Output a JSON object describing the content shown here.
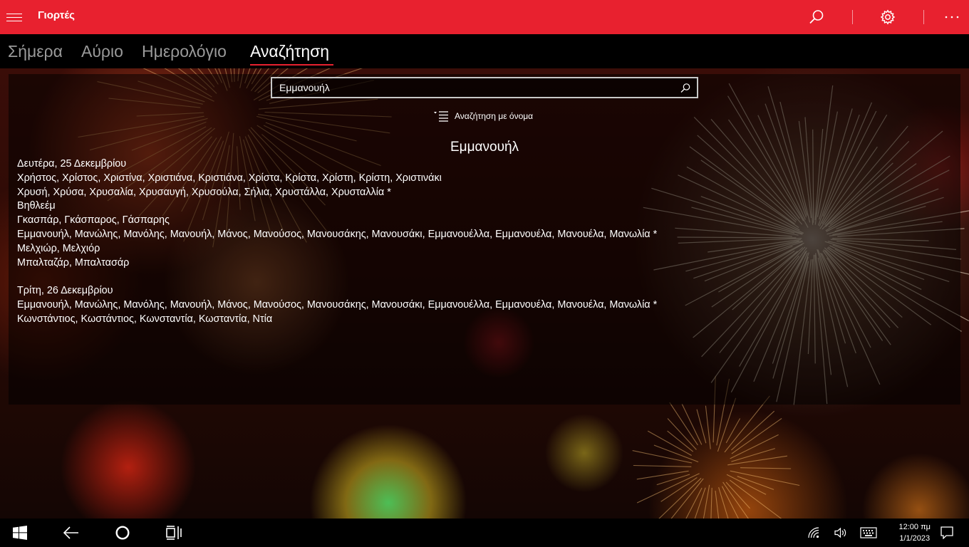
{
  "app": {
    "title": "Γιορτές"
  },
  "tabs": [
    {
      "label": "Σήμερα"
    },
    {
      "label": "Αύριο"
    },
    {
      "label": "Ημερολόγιο"
    },
    {
      "label": "Αναζήτηση",
      "active": true
    }
  ],
  "search": {
    "value": "Εμμανουήλ",
    "filter_label": "Αναζήτηση με όνομα"
  },
  "result": {
    "title": "Εμμανουήλ",
    "days": [
      {
        "date": "Δευτέρα, 25 Δεκεμβρίου",
        "names": [
          "Χρήστος, Χρίστος, Χριστίνα, Χριστιάνα, Κριστιάνα, Χρίστα, Κρίστα, Χρίστη, Κρίστη, Χριστινάκι",
          "Χρυσή, Χρύσα, Χρυσαλία, Χρυσαυγή, Χρυσούλα, Σήλια, Χρυστάλλα, Χρυσταλλία *",
          "Βηθλεέμ",
          "Γκασπάρ, Γκάσπαρος, Γάσπαρης",
          "Εμμανουήλ, Μανώλης, Μανόλης, Μανουήλ, Μάνος, Μανούσος, Μανουσάκης, Μανουσάκι, Εμμανουέλλα, Εμμανουέλα, Μανουέλα, Μανωλία *",
          "Μελχιώρ, Μελχιόρ",
          "Μπαλταζάρ, Μπαλτασάρ"
        ]
      },
      {
        "date": "Τρίτη, 26 Δεκεμβρίου",
        "names": [
          "Εμμανουήλ, Μανώλης, Μανόλης, Μανουήλ, Μάνος, Μανούσος, Μανουσάκης, Μανουσάκι, Εμμανουέλλα, Εμμανουέλα, Μανουέλα, Μανωλία *",
          "Κωνστάντιος, Κωστάντιος, Κωνσταντία, Κωσταντία, Ντία"
        ]
      }
    ]
  },
  "taskbar": {
    "time": "12:00 πμ",
    "date": "1/1/2023"
  },
  "colors": {
    "accent": "#e8212f",
    "tab_inactive": "#9a9a9a"
  },
  "icons": [
    "hamburger-icon",
    "search-icon",
    "settings-gear-icon",
    "more-icon",
    "filter-list-icon",
    "windows-start-icon",
    "back-arrow-icon",
    "cortana-circle-icon",
    "task-view-icon",
    "network-icon",
    "volume-icon",
    "keyboard-icon",
    "notification-icon"
  ]
}
